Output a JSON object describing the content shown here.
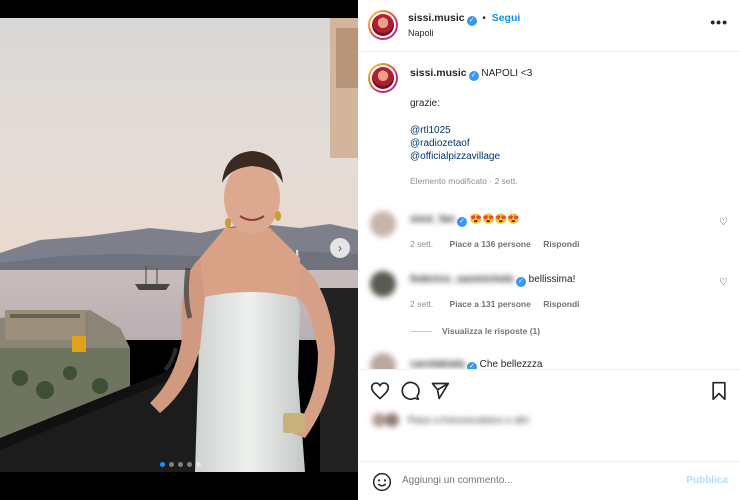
{
  "post": {
    "username": "sissi.music",
    "follow_label": "Segui",
    "location": "Napoli",
    "more_label": "•••"
  },
  "caption": {
    "text": "NAPOLI <3",
    "line2": "grazie:",
    "tags": [
      "@rtl1025",
      "@radiozetaof",
      "@officialpizzavillage"
    ],
    "meta": "Elemento modificato · 2 sett."
  },
  "comments": [
    {
      "username": "sissi_fan",
      "text": "😍😍😍😍",
      "time": "2 sett.",
      "likes": "Piace a 136 persone",
      "reply_label": "Rispondi"
    },
    {
      "username": "federico_sanmichele",
      "text": "bellissima!",
      "time": "2 sett.",
      "likes": "Piace a 131 persone",
      "reply_label": "Rispondi",
      "view_replies": "Visualizza le risposte (1)"
    },
    {
      "username": "carolabiala",
      "text": "Che bellezzza"
    }
  ],
  "likes_row": {
    "text": "Piace a francescaliano e altri"
  },
  "composer": {
    "placeholder": "Aggiungi un commento...",
    "publish_label": "Pubblica"
  },
  "carousel": {
    "total_slides": 5,
    "active_index": 0,
    "next_icon": "chevron-right-icon"
  },
  "icons": {
    "like": "heart-icon",
    "comment": "comment-icon",
    "share": "share-icon",
    "save": "bookmark-icon",
    "emoji": "emoji-icon"
  },
  "colors": {
    "accent": "#0095f6",
    "link": "#00376b",
    "muted": "#8e8e8e",
    "publish_disabled": "#b2dffc",
    "verified": "#3897f0"
  }
}
